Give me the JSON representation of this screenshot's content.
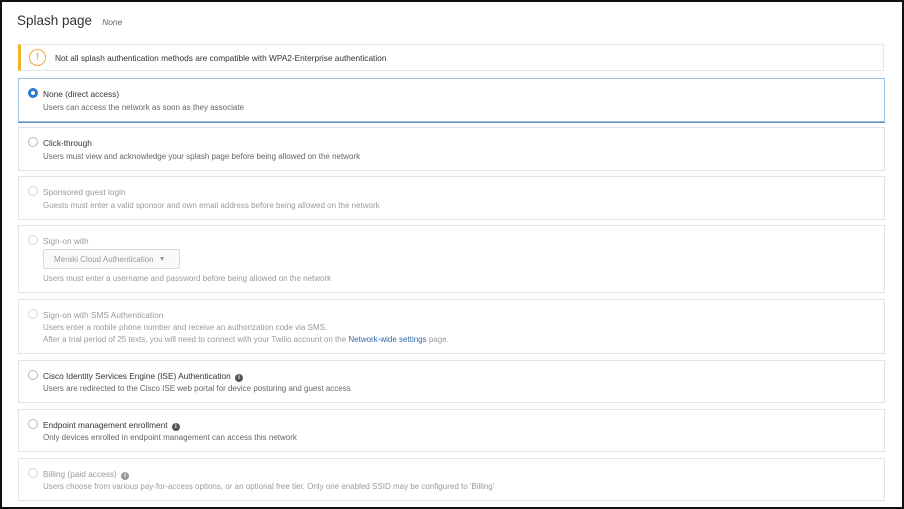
{
  "header": {
    "title": "Splash page",
    "subtitle": "None"
  },
  "warning": {
    "icon": "warning-icon",
    "text": "Not all splash authentication methods are compatible with WPA2-Enterprise authentication"
  },
  "options": [
    {
      "title": "None (direct access)",
      "desc": "Users can access the network as soon as they associate",
      "selected": true,
      "disabled": false
    },
    {
      "title": "Click-through",
      "desc": "Users must view and acknowledge your splash page before being allowed on the network",
      "selected": false,
      "disabled": false
    },
    {
      "title": "Sponsored guest login",
      "desc": "Guests must enter a valid sponsor and own email address before being allowed on the network",
      "selected": false,
      "disabled": true
    },
    {
      "title": "Sign-on with",
      "dropdown": "Meraki Cloud Authentication",
      "desc": "Users must enter a username and password before being allowed on the network",
      "selected": false,
      "disabled": true
    },
    {
      "title": "Sign-on with SMS Authentication",
      "desc": "Users enter a mobile phone number and receive an authorization code via SMS.",
      "desc2_prefix": "After a trial period of 25 texts, you will need to connect with your Twilio account on the",
      "desc2_link": "Network-wide settings",
      "desc2_suffix": "page.",
      "selected": false,
      "disabled": true
    },
    {
      "title": "Cisco Identity Services Engine (ISE) Authentication",
      "desc": "Users are redirected to the Cisco ISE web portal for device posturing and guest access",
      "selected": false,
      "disabled": false
    },
    {
      "title": "Endpoint management enrollment",
      "desc": "Only devices enrolled in endpoint management can access this network",
      "selected": false,
      "disabled": false
    },
    {
      "title": "Billing (paid access)",
      "desc": "Users choose from various pay-for-access options, or an optional free tier. Only one enabled SSID may be configured to 'Billing'",
      "selected": false,
      "disabled": true
    }
  ]
}
